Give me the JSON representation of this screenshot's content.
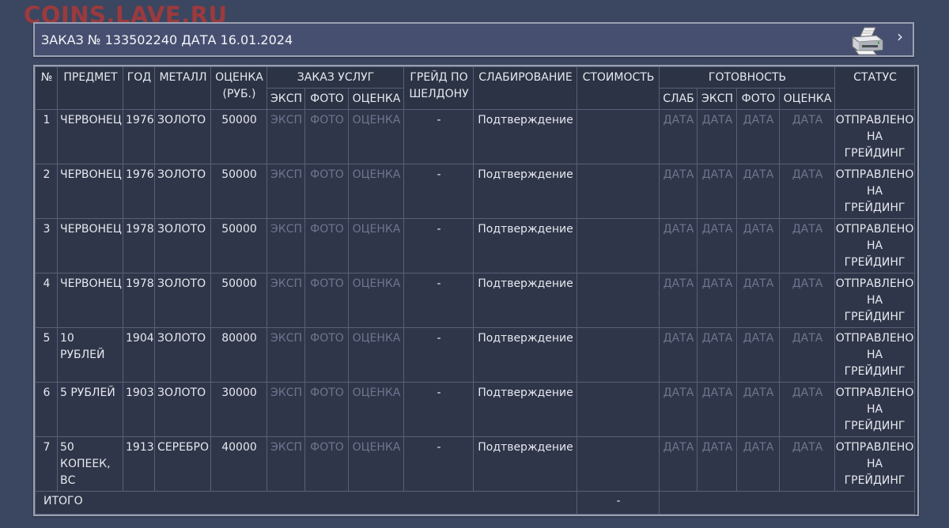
{
  "watermark": "COINS.LAVE.RU",
  "order": {
    "title": "ЗАКАЗ № 133502240 ДАТА 16.01.2024"
  },
  "table": {
    "headers": {
      "num": "№",
      "item": "ПРЕДМЕТ",
      "year": "ГОД",
      "metal": "МЕТАЛЛ",
      "valuation": "ОЦЕНКА (РУБ.)",
      "services": "ЗАКАЗ УСЛУГ",
      "services_exp": "ЭКСП",
      "services_photo": "ФОТО",
      "services_eval": "ОЦЕНКА",
      "grade": "ГРЕЙД ПО ШЕЛДОНУ",
      "slab": "СЛАБИРОВАНИЕ",
      "cost": "СТОИМОСТЬ",
      "readiness": "ГОТОВНОСТЬ",
      "ready_slab": "СЛАБ",
      "ready_exp": "ЭКСП",
      "ready_photo": "ФОТО",
      "ready_eval": "ОЦЕНКА",
      "status": "СТАТУС"
    },
    "rows": [
      {
        "num": "1",
        "item": "ЧЕРВОНЕЦ",
        "year": "1976",
        "metal": "ЗОЛОТО",
        "valuation": "50000",
        "svc_exp": "ЭКСП",
        "svc_photo": "ФОТО",
        "svc_eval": "ОЦЕНКА",
        "grade": "-",
        "slab": "Подтверждение",
        "cost": "",
        "rd_slab": "ДАТА",
        "rd_exp": "ДАТА",
        "rd_photo": "ДАТА",
        "rd_eval": "ДАТА",
        "status": "ОТПРАВЛЕНО НА ГРЕЙДИНГ"
      },
      {
        "num": "2",
        "item": "ЧЕРВОНЕЦ",
        "year": "1976",
        "metal": "ЗОЛОТО",
        "valuation": "50000",
        "svc_exp": "ЭКСП",
        "svc_photo": "ФОТО",
        "svc_eval": "ОЦЕНКА",
        "grade": "-",
        "slab": "Подтверждение",
        "cost": "",
        "rd_slab": "ДАТА",
        "rd_exp": "ДАТА",
        "rd_photo": "ДАТА",
        "rd_eval": "ДАТА",
        "status": "ОТПРАВЛЕНО НА ГРЕЙДИНГ"
      },
      {
        "num": "3",
        "item": "ЧЕРВОНЕЦ",
        "year": "1978",
        "metal": "ЗОЛОТО",
        "valuation": "50000",
        "svc_exp": "ЭКСП",
        "svc_photo": "ФОТО",
        "svc_eval": "ОЦЕНКА",
        "grade": "-",
        "slab": "Подтверждение",
        "cost": "",
        "rd_slab": "ДАТА",
        "rd_exp": "ДАТА",
        "rd_photo": "ДАТА",
        "rd_eval": "ДАТА",
        "status": "ОТПРАВЛЕНО НА ГРЕЙДИНГ"
      },
      {
        "num": "4",
        "item": "ЧЕРВОНЕЦ",
        "year": "1978",
        "metal": "ЗОЛОТО",
        "valuation": "50000",
        "svc_exp": "ЭКСП",
        "svc_photo": "ФОТО",
        "svc_eval": "ОЦЕНКА",
        "grade": "-",
        "slab": "Подтверждение",
        "cost": "",
        "rd_slab": "ДАТА",
        "rd_exp": "ДАТА",
        "rd_photo": "ДАТА",
        "rd_eval": "ДАТА",
        "status": "ОТПРАВЛЕНО НА ГРЕЙДИНГ"
      },
      {
        "num": "5",
        "item": "10 РУБЛЕЙ",
        "year": "1904",
        "metal": "ЗОЛОТО",
        "valuation": "80000",
        "svc_exp": "ЭКСП",
        "svc_photo": "ФОТО",
        "svc_eval": "ОЦЕНКА",
        "grade": "-",
        "slab": "Подтверждение",
        "cost": "",
        "rd_slab": "ДАТА",
        "rd_exp": "ДАТА",
        "rd_photo": "ДАТА",
        "rd_eval": "ДАТА",
        "status": "ОТПРАВЛЕНО НА ГРЕЙДИНГ"
      },
      {
        "num": "6",
        "item": "5 РУБЛЕЙ",
        "year": "1903",
        "metal": "ЗОЛОТО",
        "valuation": "30000",
        "svc_exp": "ЭКСП",
        "svc_photo": "ФОТО",
        "svc_eval": "ОЦЕНКА",
        "grade": "-",
        "slab": "Подтверждение",
        "cost": "",
        "rd_slab": "ДАТА",
        "rd_exp": "ДАТА",
        "rd_photo": "ДАТА",
        "rd_eval": "ДАТА",
        "status": "ОТПРАВЛЕНО НА ГРЕЙДИНГ"
      },
      {
        "num": "7",
        "item": "50 КОПЕЕК, ВС",
        "year": "1913",
        "metal": "СЕРЕБРО",
        "valuation": "40000",
        "svc_exp": "ЭКСП",
        "svc_photo": "ФОТО",
        "svc_eval": "ОЦЕНКА",
        "grade": "-",
        "slab": "Подтверждение",
        "cost": "",
        "rd_slab": "ДАТА",
        "rd_exp": "ДАТА",
        "rd_photo": "ДАТА",
        "rd_eval": "ДАТА",
        "status": "ОТПРАВЛЕНО НА ГРЕЙДИНГ"
      }
    ],
    "total": {
      "label": "ИТОГО",
      "cost": "-"
    }
  },
  "colors": {
    "background": "#3b4660",
    "header_bar": "#474f70",
    "table_bg": "#303649",
    "dim_text": "#6e7690",
    "watermark": "#be3732"
  },
  "icons": {
    "print": "printer-icon",
    "next": "chevron-right-icon"
  }
}
